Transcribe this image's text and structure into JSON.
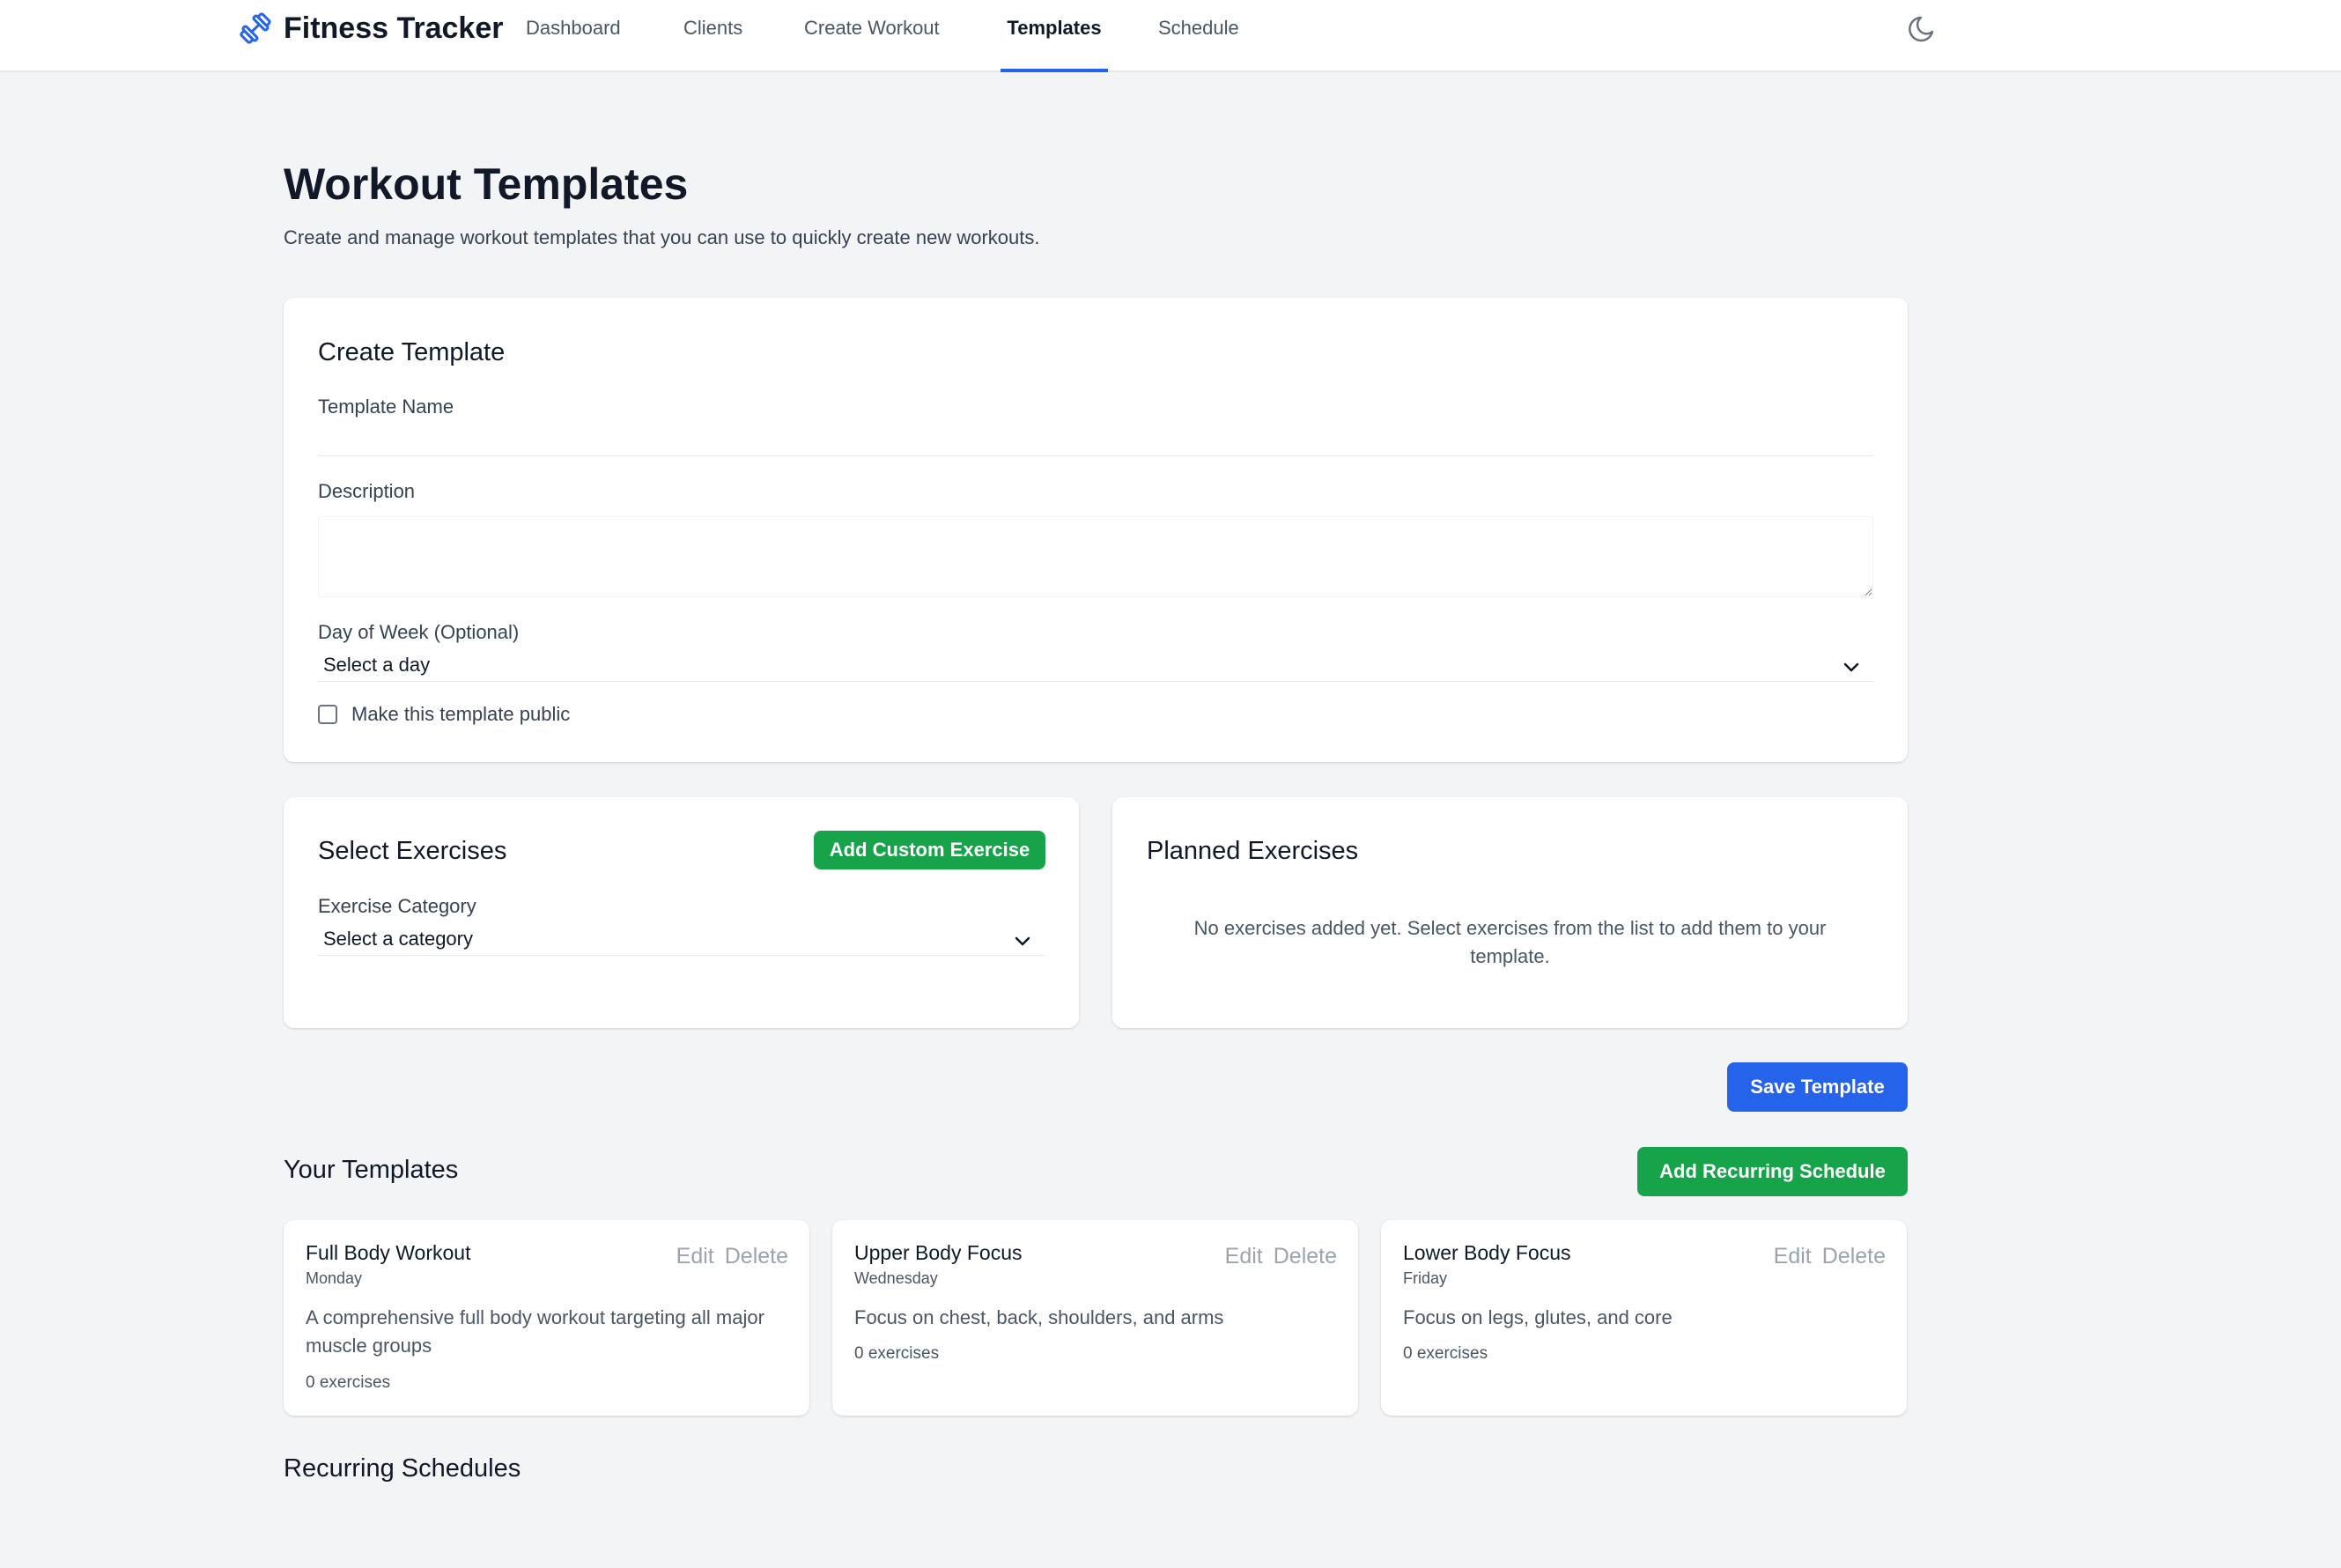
{
  "app": {
    "title": "Fitness Tracker",
    "nav": [
      {
        "label": "Dashboard"
      },
      {
        "label": "Clients"
      },
      {
        "label": "Create Workout"
      },
      {
        "label": "Templates",
        "active": true
      },
      {
        "label": "Schedule"
      }
    ],
    "icons": {
      "logo": "dumbbell-icon",
      "theme": "moon-icon"
    },
    "accent": "#2563eb"
  },
  "page": {
    "title": "Workout Templates",
    "subtitle": "Create and manage workout templates that you can use to quickly create new workouts."
  },
  "create_template": {
    "title": "Create Template",
    "name_label": "Template Name",
    "name_value": "",
    "description_label": "Description",
    "description_value": "",
    "day_label": "Day of Week (Optional)",
    "day_selected": "Select a day",
    "public_label": "Make this template public",
    "public_checked": false
  },
  "select_exercises": {
    "title": "Select Exercises",
    "add_custom_label": "Add Custom Exercise",
    "category_label": "Exercise Category",
    "category_selected": "Select a category"
  },
  "planned_exercises": {
    "title": "Planned Exercises",
    "empty_text": "No exercises added yet. Select exercises from the list to add them to your template."
  },
  "save_button_label": "Save Template",
  "your_templates": {
    "title": "Your Templates",
    "add_recurring_label": "Add Recurring Schedule",
    "edit_label": "Edit",
    "delete_label": "Delete",
    "items": [
      {
        "name": "Full Body Workout",
        "day": "Monday",
        "description": "A comprehensive full body workout targeting all major muscle groups",
        "count": "0 exercises"
      },
      {
        "name": "Upper Body Focus",
        "day": "Wednesday",
        "description": "Focus on chest, back, shoulders, and arms",
        "count": "0 exercises"
      },
      {
        "name": "Lower Body Focus",
        "day": "Friday",
        "description": "Focus on legs, glutes, and core",
        "count": "0 exercises"
      }
    ]
  },
  "recurring_schedules": {
    "title": "Recurring Schedules"
  },
  "colors": {
    "green": "#16a34a",
    "blue": "#2563eb",
    "background": "#f3f4f6"
  }
}
